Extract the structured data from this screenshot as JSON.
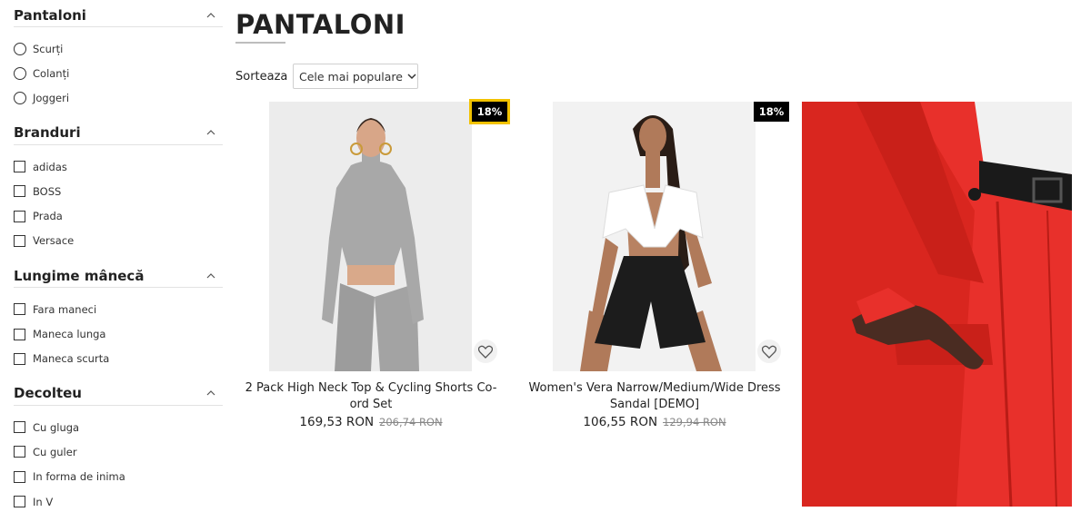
{
  "filters": {
    "pantaloni": {
      "title": "Pantaloni",
      "options": [
        "Scurți",
        "Colanți",
        "Joggeri"
      ]
    },
    "branduri": {
      "title": "Branduri",
      "options": [
        "adidas",
        "BOSS",
        "Prada",
        "Versace"
      ]
    },
    "lungime": {
      "title": "Lungime mânecă",
      "options": [
        "Fara maneci",
        "Maneca lunga",
        "Maneca scurta"
      ]
    },
    "decolteu": {
      "title": "Decolteu",
      "options": [
        "Cu gluga",
        "Cu guler",
        "In forma de inima",
        "In V"
      ]
    }
  },
  "page": {
    "title": "PANTALONI",
    "sort_label": "Sorteaza",
    "sort_value": "Cele mai populare"
  },
  "products": [
    {
      "badge": "18%",
      "name": "2 Pack High Neck Top & Cycling Shorts Co-ord Set",
      "price": "169,53 RON",
      "old_price": "206,74 RON"
    },
    {
      "badge": "18%",
      "name": "Women's Vera Narrow/Medium/Wide Dress Sandal [DEMO]",
      "price": "106,55 RON",
      "old_price": "129,94 RON"
    }
  ],
  "colors": {
    "badge_bg": "#000000",
    "highlight": "#f2c200",
    "promo_red": "#e8302b"
  }
}
